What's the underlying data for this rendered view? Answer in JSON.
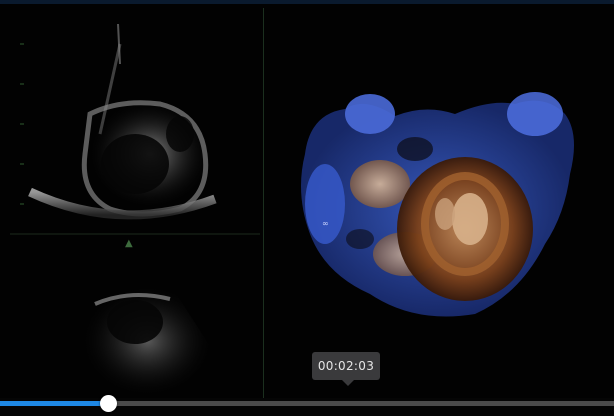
{
  "player": {
    "time_tooltip": "00:02:03",
    "progress_fraction": 0.176,
    "accent_color": "#1e88e5"
  },
  "video": {
    "left_pane_icon": "ultrasound-2d-image",
    "right_pane_icon": "ultrasound-3d-rendering"
  }
}
